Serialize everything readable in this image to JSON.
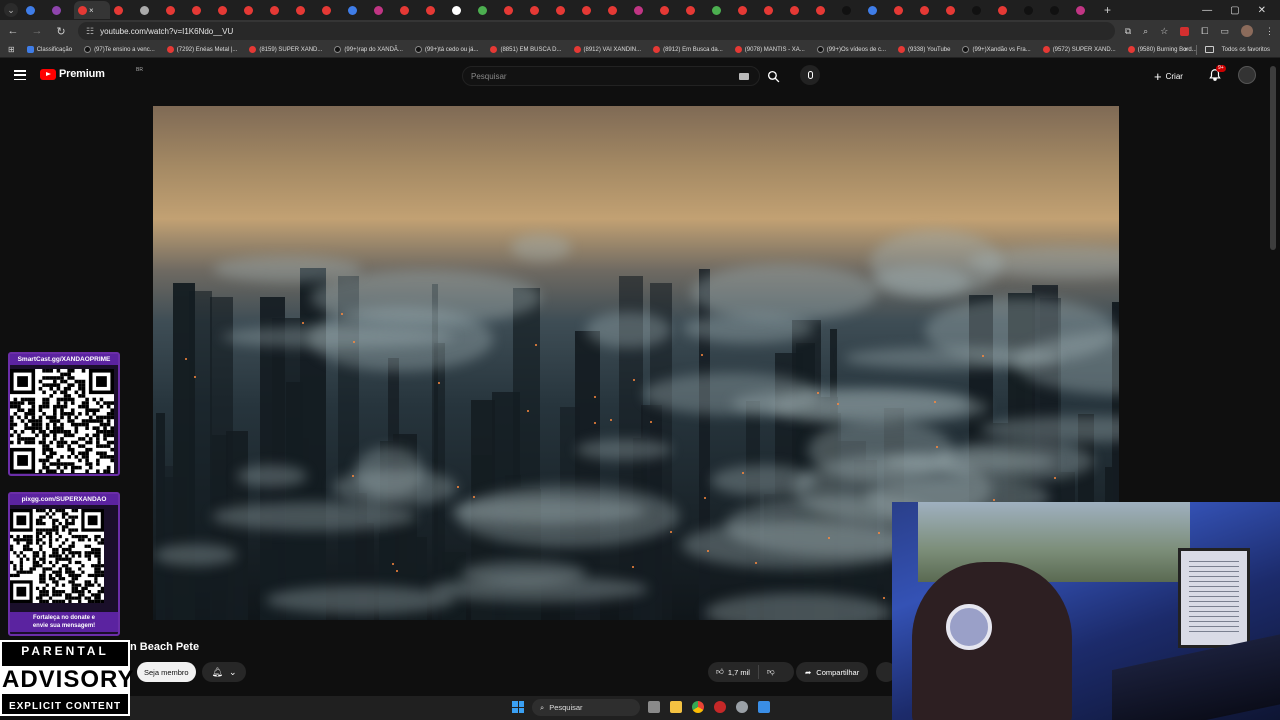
{
  "browser": {
    "tab_count_label": "",
    "active_tab_close": "×",
    "new_tab": "+",
    "address": "youtube.com/watch?v=I1K6Ndo__VU",
    "window_controls": {
      "minimize": "—",
      "maximize": "▢",
      "close": "✕"
    },
    "bookmarks": [
      {
        "label": "Classificação",
        "icon": "blue"
      },
      {
        "label": "(97)Te ensino a venc...",
        "icon": "tt"
      },
      {
        "label": "(7292) Enéas Metal |...",
        "icon": "yt"
      },
      {
        "label": "(8159) SUPER XAND...",
        "icon": "yt"
      },
      {
        "label": "(99+)rap do XANDÃ...",
        "icon": "tt"
      },
      {
        "label": "(99+)tá cedo ou já...",
        "icon": "tt"
      },
      {
        "label": "(8851) EM BUSCA D...",
        "icon": "yt"
      },
      {
        "label": "(8912) VAI XANDIN...",
        "icon": "yt"
      },
      {
        "label": "(8912) Em Busca da...",
        "icon": "yt"
      },
      {
        "label": "(9078) MANTIS - XA...",
        "icon": "yt"
      },
      {
        "label": "(99+)Os vídeos de c...",
        "icon": "tt"
      },
      {
        "label": "(9338) YouTube",
        "icon": "yt"
      },
      {
        "label": "(99+)Xandão vs Fra...",
        "icon": "tt"
      },
      {
        "label": "(9572) SUPER XAND...",
        "icon": "yt"
      },
      {
        "label": "(9580) Burning Bord...",
        "icon": "yt"
      }
    ],
    "all_bookmarks": "Todos os favoritos"
  },
  "youtube": {
    "logo_text": "Premium",
    "region": "BR",
    "search_placeholder": "Pesquisar",
    "create_label": "Criar",
    "notification_badge": "9+"
  },
  "video": {
    "title": "n Beach Pete",
    "member_label": "Seja membro",
    "likes": "1,7 mil",
    "share_label": "Compartilhar"
  },
  "overlays": {
    "qr1_caption": "SmartCast.gg/XANDAOPRIME",
    "qr2_caption": "pixgg.com/SUPERXANDAO",
    "qr2_footer_1": "Fortaleça no donate e",
    "qr2_footer_2": "envie sua mensagem!",
    "advisory_top": "PARENTAL",
    "advisory_mid": "ADVISORY",
    "advisory_bottom": "EXPLICIT CONTENT"
  },
  "taskbar": {
    "search_label": "Pesquisar"
  },
  "colors": {
    "yt_red": "#ff0000",
    "background": "#0f0f0f",
    "overlay_purple": "#5b23a0"
  }
}
